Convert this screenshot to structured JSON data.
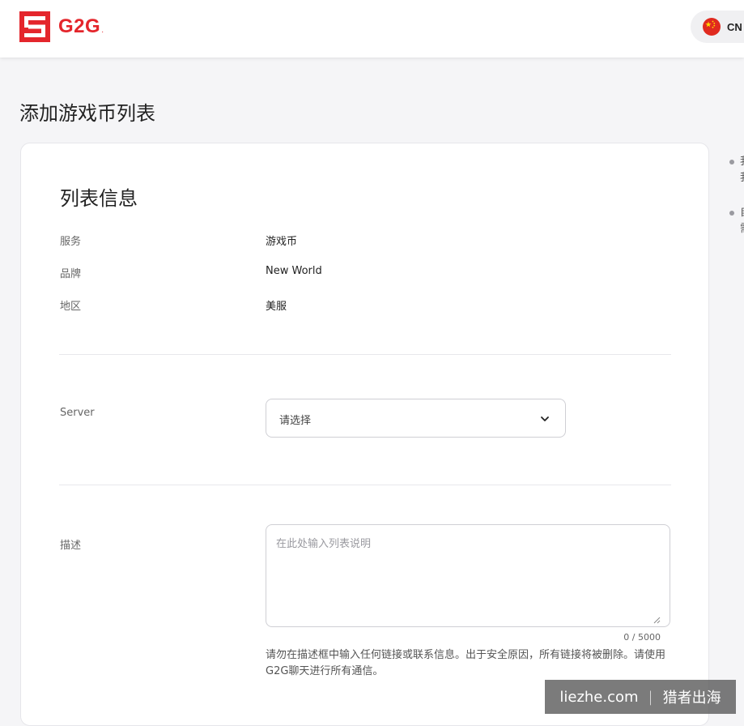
{
  "header": {
    "logo_text": "G2G",
    "logo_dot": ".",
    "language_code": "CN"
  },
  "page": {
    "title": "添加游戏币列表"
  },
  "listing_info": {
    "title": "列表信息",
    "rows": [
      {
        "label": "服务",
        "value": "游戏币"
      },
      {
        "label": "品牌",
        "value": "New World"
      },
      {
        "label": "地区",
        "value": "美服"
      }
    ]
  },
  "server": {
    "label": "Server",
    "selected": "请选择"
  },
  "description": {
    "label": "描述",
    "placeholder": "在此处输入列表说明",
    "counter": "0 / 5000",
    "warning": "请勿在描述框中输入任何链接或联系信息。出于安全原因，所有链接将被删除。请使用G2G聊天进行所有通信。"
  },
  "side_notes": [
    {
      "line1": "我",
      "line2": "我"
    },
    {
      "line1": "自",
      "line2": "需"
    }
  ],
  "watermark": {
    "left": "liezhe.com",
    "separator": "|",
    "right": "猎者出海"
  },
  "colors": {
    "brand": "#e4262c",
    "background": "#f5f5f7",
    "card": "#ffffff",
    "border": "#cfcfd4"
  }
}
